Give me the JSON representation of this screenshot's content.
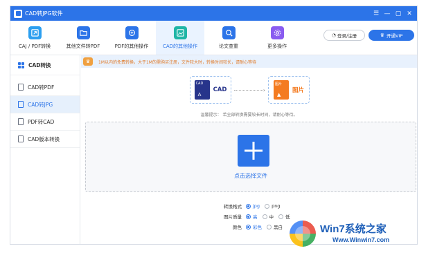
{
  "window": {
    "title": "CAD转JPG软件",
    "controls": [
      "☰",
      "—",
      "▢",
      "✕"
    ]
  },
  "toolbar": {
    "tools": [
      {
        "label": "CAJ / PDF转换",
        "icon": "caj-pdf-convert-icon",
        "color": "#2c9ff0"
      },
      {
        "label": "其他文件转PDF",
        "icon": "folder-pdf-icon",
        "color": "#2c74e8"
      },
      {
        "label": "PDF的其他操作",
        "icon": "pdf-refresh-icon",
        "color": "#2c74e8"
      },
      {
        "label": "CAD的其他操作",
        "icon": "cad-image-icon",
        "color": "#1fb5a6"
      },
      {
        "label": "论文查重",
        "icon": "paper-check-icon",
        "color": "#2c74e8"
      },
      {
        "label": "更多操作",
        "icon": "gear-icon",
        "color": "#8a5cf0"
      }
    ],
    "active_index": 3,
    "login_label": "登录/注册",
    "vip_label": "开通VIP"
  },
  "sidebar": {
    "header": "CAD转换",
    "items": [
      {
        "label": "CAD转PDF",
        "icon_text": "PDF"
      },
      {
        "label": "CAD转JPG",
        "icon_text": "JPG"
      },
      {
        "label": "PDF转CAD",
        "icon_text": "CAD"
      },
      {
        "label": "CAD版本转换",
        "icon_text": "V"
      }
    ],
    "active_index": 1
  },
  "notice": {
    "text": "1M以内的免费转换，大于1M的需购买注册，文件较大时，转换时间较长，请耐心等待"
  },
  "conversion": {
    "from_label": "CAD",
    "from_tag": "CAD",
    "to_label": "图片",
    "to_tag": "图片",
    "tip": "温馨提示：  若全部转换需要较长时间，请耐心等待。"
  },
  "dropzone": {
    "label": "点击选择文件"
  },
  "options": {
    "format": {
      "label": "转换格式",
      "choices": [
        "jpg",
        "png"
      ],
      "selected": "jpg"
    },
    "quality": {
      "label": "图片质量",
      "choices": [
        "高",
        "中",
        "低"
      ],
      "selected": "高"
    },
    "color": {
      "label": "颜色",
      "choices": [
        "彩色",
        "黑白"
      ],
      "selected": "彩色"
    }
  },
  "watermark": {
    "title": "Win7系统之家",
    "url": "Www.Winwin7.com"
  }
}
